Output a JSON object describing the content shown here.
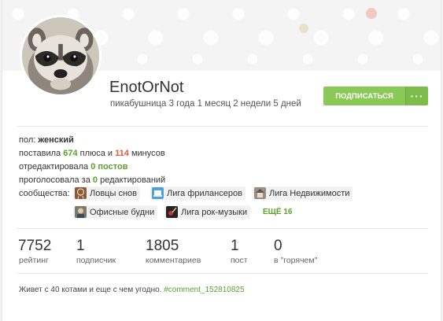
{
  "profile": {
    "username": "EnotOrNot",
    "tenure": "пикабушница 3 года 1 месяц 2 недели 5 дней",
    "subscribe_label": "ПОДПИСАТЬСЯ",
    "more_label": "···"
  },
  "info": {
    "gender_label": "пол:",
    "gender_value": "женский",
    "votes_prefix": "поставила",
    "pluses": "674",
    "pluses_suffix": "плюса и",
    "minuses": "114",
    "minuses_suffix": "минусов",
    "edited_prefix": "отредактировала",
    "edited_value": "0 постов",
    "voted_prefix": "проголосовала за",
    "voted_value": "0",
    "voted_suffix": "редактирований",
    "communities_label": "сообщества:"
  },
  "communities": [
    {
      "name": "Ловцы снов",
      "icon": "dreamcatcher-icon"
    },
    {
      "name": "Лига фрилансеров",
      "icon": "freelancer-icon"
    },
    {
      "name": "Лига Недвижимости",
      "icon": "real-estate-icon"
    },
    {
      "name": "Офисные будни",
      "icon": "office-icon"
    },
    {
      "name": "Лига рок-музыки",
      "icon": "rock-music-icon"
    }
  ],
  "more_communities": "ЕЩЁ 16",
  "stats": [
    {
      "value": "7752",
      "label": "рейтинг"
    },
    {
      "value": "1",
      "label": "подписчик"
    },
    {
      "value": "1805",
      "label": "комментариев"
    },
    {
      "value": "1",
      "label": "пост"
    },
    {
      "value": "0",
      "label": "в \"горячем\""
    }
  ],
  "bio": {
    "text": "Живет с 40 котами и еще с чем угодно.",
    "link": "#comment_152810825"
  },
  "colors": {
    "accent_green": "#8ac858",
    "plus_green": "#5aa12b",
    "minus_red": "#e25a3b"
  }
}
